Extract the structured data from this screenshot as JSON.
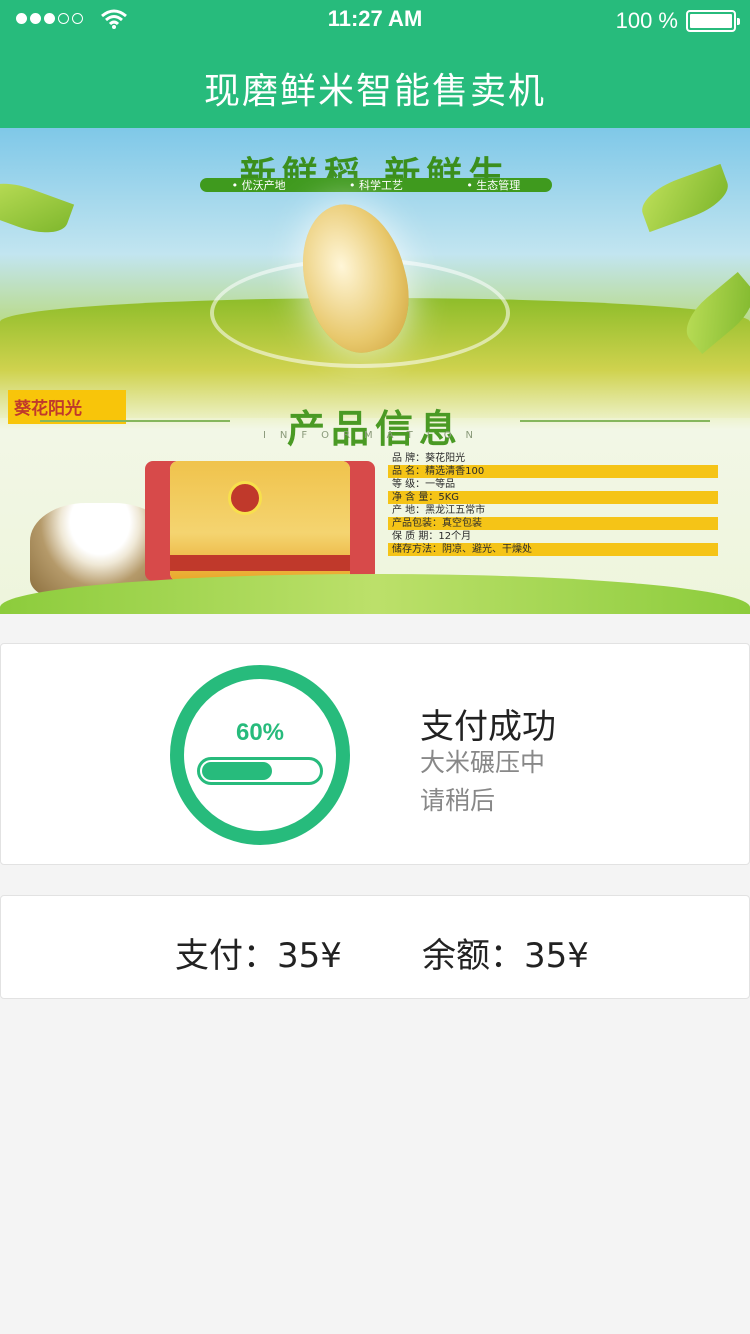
{
  "status_bar": {
    "time": "11:27 AM",
    "battery": "100 %",
    "signal_icon": "signal-dots-icon",
    "wifi_icon": "wifi-icon",
    "battery_icon": "battery-icon"
  },
  "header": {
    "title": "现磨鲜米智能售卖机"
  },
  "banner": {
    "slogan": "新鲜稻  新鲜生",
    "slogan_tags": [
      "• 优沃产地",
      "• 科学工艺",
      "• 生态管理"
    ],
    "brand_tag": "葵花阳光",
    "info_title": "产品信息",
    "info_subtitle": "INFORMATION",
    "specs": [
      "品      牌：葵花阳光",
      "品      名：精选清香100",
      "等      级：一等品",
      "净  含  量：5KG",
      "产      地：黑龙江五常市",
      "产品包装：真空包装",
      "保  质  期：12个月",
      "储存方法：阴凉、避光、干燥处"
    ]
  },
  "progress": {
    "percent_label": "60%",
    "value": 0.6,
    "title": "支付成功",
    "line1": "大米碾压中",
    "line2": "请稍后"
  },
  "payment": {
    "paid": "支付：35¥",
    "balance": "余额：35¥"
  },
  "colors": {
    "accent": "#27bb7c",
    "background": "#f4f4f4",
    "spec_highlight": "#f5c417"
  }
}
